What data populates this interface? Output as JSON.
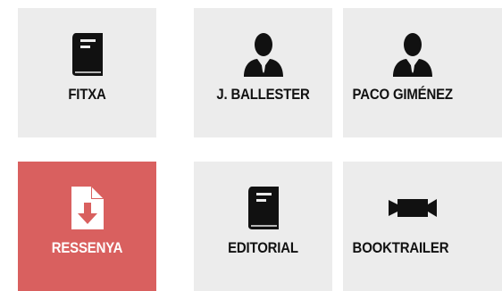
{
  "tiles": [
    {
      "label": "FITXA",
      "icon": "book-icon",
      "active": false
    },
    {
      "label": "J. BALLESTER",
      "icon": "person-icon",
      "active": false
    },
    {
      "label": "PACO GIMÉNEZ",
      "icon": "person-icon",
      "active": false
    },
    {
      "label": "RESSENYA",
      "icon": "document-download-icon",
      "active": true
    },
    {
      "label": "EDITORIAL",
      "icon": "book-icon",
      "active": false
    },
    {
      "label": "BOOKTRAILER",
      "icon": "video-camera-icon",
      "active": false
    }
  ],
  "colors": {
    "tile_background": "#ececec",
    "active_tile_background": "#d9605f",
    "label_text": "#111111",
    "active_label_text": "#ffffff",
    "icon_dark": "#111111"
  }
}
